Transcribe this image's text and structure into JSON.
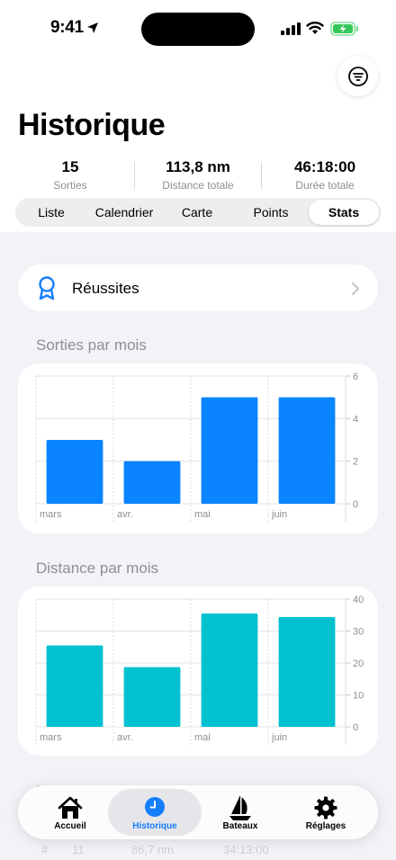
{
  "status": {
    "time": "9:41"
  },
  "page": {
    "title": "Historique"
  },
  "summary": [
    {
      "value": "15",
      "label": "Sorties"
    },
    {
      "value": "113,8 nm",
      "label": "Distance totale"
    },
    {
      "value": "46:18:00",
      "label": "Durée totale"
    }
  ],
  "segments": [
    "Liste",
    "Calendrier",
    "Carte",
    "Points",
    "Stats"
  ],
  "active_segment": "Stats",
  "reussites": {
    "label": "Réussites"
  },
  "sections": {
    "sorties_title": "Sorties par mois",
    "distance_title": "Distance par mois",
    "next_title": "D"
  },
  "peek_row": {
    "hash": "#",
    "count": "11",
    "distance": "86,7 nm",
    "duration": "34:13:00"
  },
  "tabs": [
    {
      "label": "Accueil",
      "icon": "house-icon"
    },
    {
      "label": "Historique",
      "icon": "clock-icon"
    },
    {
      "label": "Bateaux",
      "icon": "sailboat-icon"
    },
    {
      "label": "Réglages",
      "icon": "gear-icon"
    }
  ],
  "active_tab": "Historique",
  "colors": {
    "sorties_bar": "#0a84ff",
    "distance_bar": "#00c1d0",
    "accent": "#147efb"
  },
  "chart_data": [
    {
      "type": "bar",
      "categories": [
        "mars",
        "avr.",
        "mai",
        "juin"
      ],
      "values": [
        3,
        2,
        5,
        5
      ],
      "title": "Sorties par mois",
      "ylim": [
        0,
        6
      ],
      "yticks": [
        0,
        2,
        4,
        6
      ],
      "grid": true
    },
    {
      "type": "bar",
      "categories": [
        "mars",
        "avr.",
        "mai",
        "juin"
      ],
      "values": [
        25.5,
        18.7,
        35.5,
        34.4
      ],
      "title": "Distance par mois",
      "ylim": [
        0,
        40
      ],
      "yticks": [
        0,
        10,
        20,
        30,
        40
      ],
      "grid": true
    }
  ]
}
